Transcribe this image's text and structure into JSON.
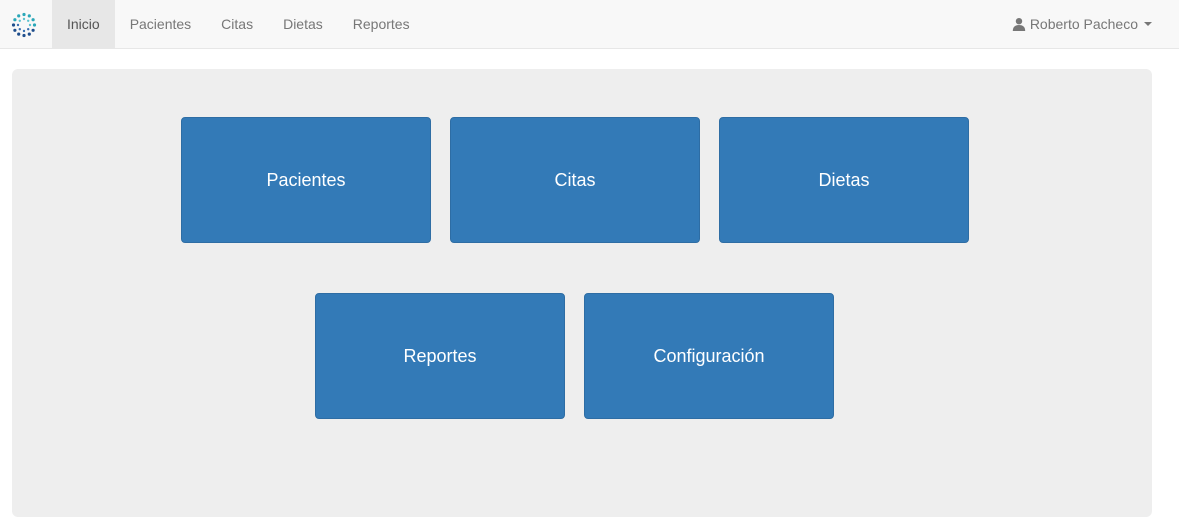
{
  "navbar": {
    "brand_icon": "circular-dots-logo-icon",
    "items": [
      {
        "label": "Inicio",
        "active": true
      },
      {
        "label": "Pacientes",
        "active": false
      },
      {
        "label": "Citas",
        "active": false
      },
      {
        "label": "Dietas",
        "active": false
      },
      {
        "label": "Reportes",
        "active": false
      }
    ],
    "user": {
      "icon": "user-icon",
      "name": "Roberto Pacheco",
      "dropdown_icon": "caret-down-icon"
    }
  },
  "main": {
    "tiles": [
      {
        "label": "Pacientes"
      },
      {
        "label": "Citas"
      },
      {
        "label": "Dietas"
      },
      {
        "label": "Reportes"
      },
      {
        "label": "Configuración"
      }
    ]
  },
  "colors": {
    "navbar_bg": "#f8f8f8",
    "active_tab_bg": "#e7e7e7",
    "panel_bg": "#eeeeee",
    "tile_bg": "#337ab7",
    "logo_teal": "#2aa7b8",
    "logo_navy": "#1f4e8c"
  }
}
